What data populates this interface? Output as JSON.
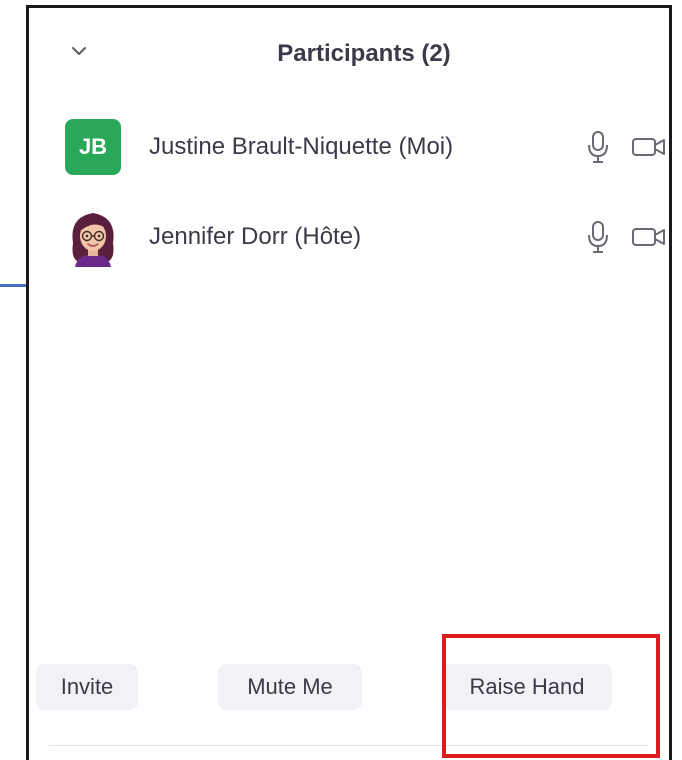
{
  "panel": {
    "title": "Participants (2)",
    "collapse_icon": "chevron-down-icon"
  },
  "participants": [
    {
      "initials": "JB",
      "name": "Justine Brault-Niquette (Moi)",
      "avatar_color": "#2aa85a",
      "icons": [
        "microphone-icon",
        "video-camera-icon"
      ]
    },
    {
      "name": "Jennifer Dorr (Hôte)",
      "avatar": "cartoon-woman-avatar",
      "icons": [
        "microphone-icon",
        "video-camera-icon"
      ]
    }
  ],
  "footer": {
    "invite_label": "Invite",
    "mute_label": "Mute Me",
    "raise_hand_label": "Raise Hand"
  },
  "colors": {
    "highlight": "#e0191e",
    "button_bg": "#f2f2f6",
    "text": "#3a3a48"
  }
}
